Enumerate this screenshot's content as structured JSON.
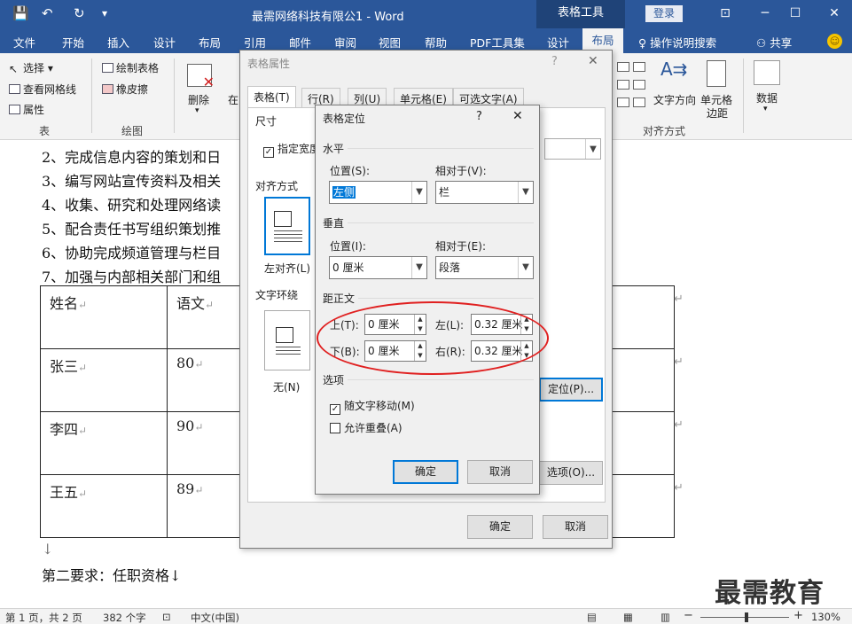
{
  "titlebar": {
    "doc_title": "最需网络科技有限公1 - Word",
    "context_group": "表格工具",
    "login": "登录",
    "save_icon": "save-icon",
    "undo_icon": "undo-icon",
    "redo_icon": "redo-icon"
  },
  "tabs": [
    "文件",
    "开始",
    "插入",
    "设计",
    "布局",
    "引用",
    "邮件",
    "审阅",
    "视图",
    "帮助",
    "PDF工具集",
    "设计"
  ],
  "active_tab": "布局",
  "search_label": "操作说明搜索",
  "share_label": "共享",
  "ribbon": {
    "select": "选择",
    "view_gridlines": "查看网格线",
    "properties": "属性",
    "group_table": "表",
    "draw_table": "绘制表格",
    "eraser": "橡皮擦",
    "group_draw": "绘图",
    "delete": "删除",
    "insert_partial": "在",
    "text_direction": "文字方向",
    "cell_margins_1": "单元格",
    "cell_margins_2": "边距",
    "data": "数据",
    "group_align": "对齐方式"
  },
  "document": {
    "paragraphs": [
      "2、完成信息内容的策划和日",
      "3、编写网站宣传资料及相关",
      "4、收集、研究和处理网络读",
      "5、配合责任书写组织策划推",
      "6、协助完成频道管理与栏目",
      "7、加强与内部相关部门和组"
    ],
    "table": [
      [
        "姓名",
        "语文"
      ],
      [
        "张三",
        "80"
      ],
      [
        "李四",
        "90"
      ],
      [
        "王五",
        "89"
      ]
    ],
    "after_table": "↓",
    "section2": "第二要求：任职资格↓"
  },
  "props_dialog": {
    "title": "表格属性",
    "help": "?",
    "close": "✕",
    "tabs": [
      "表格(T)",
      "行(R)",
      "列(U)",
      "单元格(E)",
      "可选文字(A)"
    ],
    "size_label": "尺寸",
    "preferred_width": "指定宽度",
    "alignment_label": "对齐方式",
    "align_left": "左对齐(L)",
    "wrap_label": "文字环绕",
    "wrap_none": "无(N)",
    "position_btn": "定位(P)...",
    "options_btn": "选项(O)...",
    "ok": "确定",
    "cancel": "取消"
  },
  "pos_dialog": {
    "title": "表格定位",
    "help": "?",
    "close": "✕",
    "horizontal": "水平",
    "h_position_label": "位置(S):",
    "h_position_value": "左侧",
    "h_relative_label": "相对于(V):",
    "h_relative_value": "栏",
    "vertical": "垂直",
    "v_position_label": "位置(I):",
    "v_position_value": "0 厘米",
    "v_relative_label": "相对于(E):",
    "v_relative_value": "段落",
    "distance": "距正文",
    "top_label": "上(T):",
    "top_value": "0 厘米",
    "left_label": "左(L):",
    "left_value": "0.32 厘米",
    "bottom_label": "下(B):",
    "bottom_value": "0 厘米",
    "right_label": "右(R):",
    "right_value": "0.32 厘米",
    "options": "选项",
    "move_with_text": "随文字移动(M)",
    "allow_overlap": "允许重叠(A)",
    "ok": "确定",
    "cancel": "取消"
  },
  "statusbar": {
    "page": "第 1 页，共 2 页",
    "words": "382 个字",
    "language": "中文(中国)",
    "zoom": "130%",
    "minus": "−",
    "plus": "+"
  },
  "watermark": "最需教育",
  "colors": {
    "word_blue": "#2b579a",
    "highlight_red": "#e02020",
    "accent_button": "#0078d7"
  }
}
